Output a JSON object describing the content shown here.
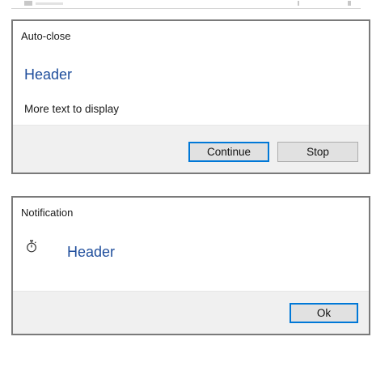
{
  "dialogs": [
    {
      "title": "Auto-close",
      "header": "Header",
      "text": "More text to display",
      "buttons": {
        "continue_label": "Continue",
        "stop_label": "Stop"
      }
    },
    {
      "title": "Notification",
      "icon": "stopwatch-icon",
      "header": "Header",
      "buttons": {
        "ok_label": "Ok"
      }
    }
  ],
  "colors": {
    "header_text": "#1f4e9c",
    "accent_border": "#0078d7",
    "footer_background": "#f0f0f0",
    "dialog_border": "#7a7a7a",
    "button_background": "#e1e1e1"
  }
}
